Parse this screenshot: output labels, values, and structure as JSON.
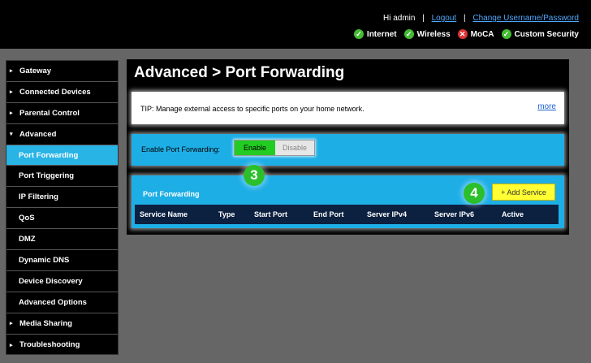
{
  "header": {
    "greeting": "Hi admin",
    "logout": "Logout",
    "change_credentials": "Change Username/Password",
    "status": [
      {
        "label": "Internet",
        "state": "ok",
        "icon": "check-circle-icon"
      },
      {
        "label": "Wireless",
        "state": "ok",
        "icon": "check-circle-icon"
      },
      {
        "label": "MoCA",
        "state": "error",
        "icon": "x-circle-icon"
      },
      {
        "label": "Custom Security",
        "state": "ok",
        "icon": "check-circle-icon"
      }
    ]
  },
  "sidebar": {
    "items": [
      {
        "label": "Gateway",
        "arrow": "▸"
      },
      {
        "label": "Connected Devices",
        "arrow": "▸"
      },
      {
        "label": "Parental Control",
        "arrow": "▸"
      },
      {
        "label": "Advanced",
        "arrow": "▾"
      },
      {
        "label": "Port Forwarding"
      },
      {
        "label": "Port Triggering"
      },
      {
        "label": "IP Filtering"
      },
      {
        "label": "QoS"
      },
      {
        "label": "DMZ"
      },
      {
        "label": "Dynamic DNS"
      },
      {
        "label": "Device Discovery"
      },
      {
        "label": "Advanced Options"
      },
      {
        "label": "Media Sharing",
        "arrow": "▸"
      },
      {
        "label": "Troubleshooting",
        "arrow": "▸"
      }
    ]
  },
  "main": {
    "title": "Advanced > Port Forwarding",
    "tip": "TIP: Manage external access to specific ports on your home network.",
    "more": "more",
    "enable_label": "Enable Port Forwarding:",
    "enable": "Enable",
    "disable": "Disable",
    "section_title": "Port Forwarding",
    "add_service": "+ Add Service",
    "columns": [
      "Service Name",
      "Type",
      "Start Port",
      "End Port",
      "Server IPv4",
      "Server IPv6",
      "Active"
    ]
  },
  "badges": {
    "step3": "3",
    "step4": "4"
  },
  "colors": {
    "accent": "#1eaee6",
    "active_nav": "#29b4e6",
    "enable_green": "#22cc22",
    "add_yellow": "#ffff33",
    "badge_green": "#2bbf2b"
  }
}
